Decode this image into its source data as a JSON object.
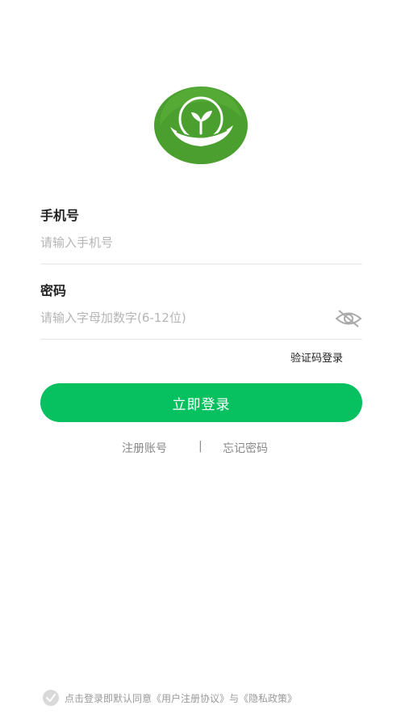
{
  "logo": {
    "icon": "sprout-logo-icon",
    "colors": {
      "green_dark": "#3f9b2a",
      "green_light": "#6cc24a"
    }
  },
  "phone": {
    "label": "手机号",
    "placeholder": "请输入手机号"
  },
  "password": {
    "label": "密码",
    "placeholder": "请输入字母加数字(6-12位)",
    "toggle_icon": "eye-hidden-icon"
  },
  "sms_login_link": "验证码登录",
  "login_button": "立即登录",
  "links": {
    "register": "注册账号",
    "separator": "|",
    "forgot": "忘记密码"
  },
  "agreement": {
    "checkbox_icon": "check-circle-icon",
    "text": "点击登录即默认同意《用户注册协议》与《隐私政策》"
  },
  "colors": {
    "primary": "#07c160",
    "placeholder": "#b5b5b5",
    "divider": "#e6e6e6"
  }
}
